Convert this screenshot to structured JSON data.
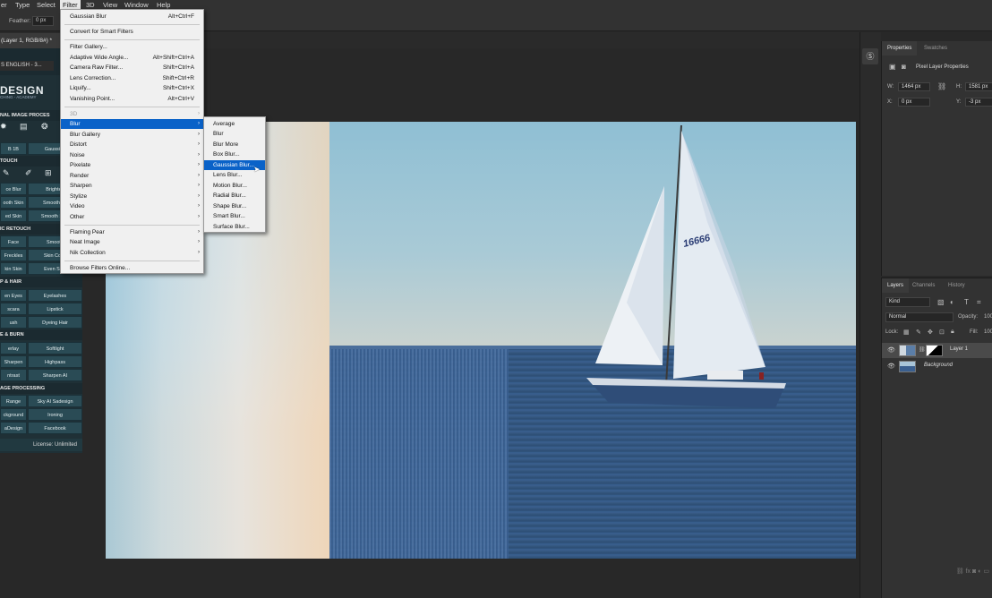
{
  "menubar": {
    "items": [
      "er",
      "Type",
      "Select",
      "Filter",
      "3D",
      "View",
      "Window",
      "Help"
    ]
  },
  "options_bar": {
    "feather_label": "Feather:",
    "feather_value": "0 px"
  },
  "document_tab": {
    "title": "(Layer 1, RGB/8#) *"
  },
  "plugin": {
    "tab_title": "S ENGLISH - 3...",
    "brand": "DESIGN",
    "brand_sub": "CHING - ACADEMY",
    "section_main": "NAL IMAGE PROCES",
    "row1": [
      "B 1B",
      "Gaussian"
    ],
    "section_touch": "TOUCH",
    "touch_rows": [
      [
        "ce Blur",
        "Brighten"
      ],
      [
        "ooth Skin",
        "Smooth Sk"
      ],
      [
        "ed Skin",
        "Smooth Skin"
      ]
    ],
    "section_basic": "IC RETOUCH",
    "basic_rows": [
      [
        "Face",
        "Smooth"
      ],
      [
        "Freckles",
        "Skin Color"
      ],
      [
        "kin Skin",
        "Even Skin"
      ]
    ],
    "section_makeup": "P & HAIR",
    "makeup_rows": [
      [
        "en Eyes",
        "Eyelashes"
      ],
      [
        "scara",
        "Lipstick"
      ],
      [
        "ush",
        "Dyeing Hair"
      ]
    ],
    "section_dodge": "E & BURN",
    "dodge_rows": [
      [
        "erlay",
        "Softlight"
      ],
      [
        "Sharpen",
        "Highpass"
      ],
      [
        "ntrast",
        "Sharpen AI"
      ]
    ],
    "section_image": "AGE PROCESSING",
    "image_rows": [
      [
        "Range",
        "Sky AI Sadesign"
      ],
      [
        "ckground",
        "Ironing"
      ],
      [
        "aDesign",
        "Facebook"
      ]
    ],
    "license": "License: Unlimited"
  },
  "filter_menu": {
    "top_items": [
      {
        "label": "Gaussian Blur",
        "shortcut": "Alt+Ctrl+F"
      }
    ],
    "convert": "Convert for Smart Filters",
    "gallery_items": [
      {
        "label": "Filter Gallery...",
        "shortcut": ""
      },
      {
        "label": "Adaptive Wide Angle...",
        "shortcut": "Alt+Shift+Ctrl+A"
      },
      {
        "label": "Camera Raw Filter...",
        "shortcut": "Shift+Ctrl+A"
      },
      {
        "label": "Lens Correction...",
        "shortcut": "Shift+Ctrl+R"
      },
      {
        "label": "Liquify...",
        "shortcut": "Shift+Ctrl+X"
      },
      {
        "label": "Vanishing Point...",
        "shortcut": "Alt+Ctrl+V"
      }
    ],
    "category_items": [
      "3D",
      "Blur",
      "Blur Gallery",
      "Distort",
      "Noise",
      "Pixelate",
      "Render",
      "Sharpen",
      "Stylize",
      "Video",
      "Other"
    ],
    "plugin_items": [
      "Flaming Pear",
      "Neat Image",
      "Nik Collection"
    ],
    "browse": "Browse Filters Online..."
  },
  "blur_menu": {
    "items": [
      "Average",
      "Blur",
      "Blur More",
      "Box Blur...",
      "Gaussian Blur...",
      "Lens Blur...",
      "Motion Blur...",
      "Radial Blur...",
      "Shape Blur...",
      "Smart Blur...",
      "Surface Blur..."
    ],
    "highlighted": "Gaussian Blur..."
  },
  "properties": {
    "tabs": [
      "Properties",
      "Swatches"
    ],
    "title": "Pixel Layer Properties",
    "w_label": "W:",
    "w_value": "1464 px",
    "h_label": "H:",
    "h_value": "1581 px",
    "x_label": "X:",
    "x_value": "0 px",
    "y_label": "Y:",
    "y_value": "-3 px"
  },
  "layers": {
    "tabs": [
      "Layers",
      "Channels",
      "History"
    ],
    "kind": "Kind",
    "blend": "Normal",
    "opacity_label": "Opacity:",
    "opacity_value": "100",
    "lock_label": "Lock:",
    "fill_label": "Fill:",
    "fill_value": "100",
    "rows": [
      {
        "name": "Layer 1"
      },
      {
        "name": "Background"
      }
    ],
    "footer": "fx"
  },
  "boat": {
    "sail_number": "16666"
  },
  "colors": {
    "accent": "#0a62c8",
    "plugin_bg": "#1f3036",
    "plugin_btn": "#2a4b55"
  }
}
